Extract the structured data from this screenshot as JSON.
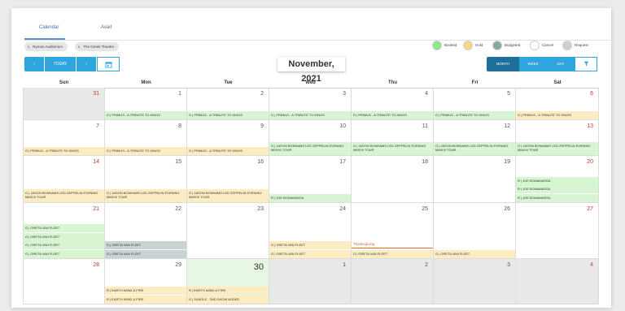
{
  "tabs": [
    {
      "label": "Calendar"
    },
    {
      "label": "Avail"
    }
  ],
  "filters": [
    {
      "label": "Ryman Auditorium",
      "remove": "x"
    },
    {
      "label": "The Greek Theatre",
      "remove": "x"
    }
  ],
  "legend": [
    {
      "label": "Booked",
      "color": "#90e88a"
    },
    {
      "label": "Hold",
      "color": "#f6d78a"
    },
    {
      "label": "Budgeted",
      "color": "#8aa7a5"
    },
    {
      "label": "Cancel",
      "color": "#ffffff"
    },
    {
      "label": "Request",
      "color": "#cfcfcf"
    }
  ],
  "nav": {
    "prev": "‹",
    "today": "TODAY",
    "next": "›",
    "calendar_icon": "calendar-icon"
  },
  "title": "November, 2021",
  "views": [
    {
      "label": "MONTH",
      "active": true
    },
    {
      "label": "WEEK",
      "active": false
    },
    {
      "label": "DAY",
      "active": false
    }
  ],
  "filter_icon": "filter-icon",
  "weekdays": [
    "Sun",
    "Mon",
    "Tue",
    "Wed",
    "Thu",
    "Fri",
    "Sat"
  ],
  "weeks": [
    {
      "days": [
        {
          "num": "31",
          "style": "gray",
          "red": true,
          "events": []
        },
        {
          "num": "1",
          "events": [
            {
              "text": "G | PRIMUS - A TRIBUTE TO KINGS",
              "type": "booked"
            }
          ]
        },
        {
          "num": "2",
          "events": [
            {
              "text": "G | PRIMUS - A TRIBUTE TO KINGS",
              "type": "booked"
            }
          ]
        },
        {
          "num": "3",
          "events": [
            {
              "text": "G | PRIMUS - A TRIBUTE TO KINGS",
              "type": "booked"
            }
          ]
        },
        {
          "num": "4",
          "events": [
            {
              "text": "G | PRIMUS - A TRIBUTE TO KINGS",
              "type": "booked"
            }
          ]
        },
        {
          "num": "5",
          "events": [
            {
              "text": "G | PRIMUS - A TRIBUTE TO KINGS",
              "type": "booked"
            }
          ]
        },
        {
          "num": "6",
          "red": true,
          "events": [
            {
              "text": "G | PRIMUS - A TRIBUTE TO KINGS",
              "type": "hold"
            }
          ]
        }
      ]
    },
    {
      "days": [
        {
          "num": "7",
          "red": true,
          "events": [
            {
              "text": "G | PRIMUS - A TRIBUTE TO KINGS",
              "type": "hold"
            }
          ]
        },
        {
          "num": "8",
          "events": [
            {
              "text": "G | PRIMUS - A TRIBUTE TO KINGS",
              "type": "hold"
            }
          ]
        },
        {
          "num": "9",
          "events": [
            {
              "text": "G | PRIMUS - A TRIBUTE TO KINGS",
              "type": "hold"
            }
          ]
        },
        {
          "num": "10",
          "events": [
            {
              "text": "G | JASON BONHAMS LED ZEPPELIN EVENING MMXXI TOUR",
              "type": "booked"
            }
          ]
        },
        {
          "num": "11",
          "events": [
            {
              "text": "G | JASON BONHAMS LED ZEPPELIN EVENING MMXXI TOUR",
              "type": "booked"
            }
          ]
        },
        {
          "num": "12",
          "events": [
            {
              "text": "G | JASON BONHAMS LED ZEPPELIN EVENING MMXXI TOUR",
              "type": "booked"
            }
          ]
        },
        {
          "num": "13",
          "red": true,
          "events": [
            {
              "text": "G | JASON BONHAMS LED ZEPPELIN EVENING MMXXI TOUR",
              "type": "booked"
            }
          ]
        }
      ]
    },
    {
      "days": [
        {
          "num": "14",
          "red": true,
          "events": [
            {
              "text": "G | JASON BONHAMS LED ZEPPELIN EVENING MMXXI TOUR",
              "type": "hold"
            }
          ]
        },
        {
          "num": "15",
          "events": [
            {
              "text": "G | JASON BONHAMS LED ZEPPELIN EVENING MMXXI TOUR",
              "type": "hold"
            }
          ]
        },
        {
          "num": "16",
          "events": [
            {
              "text": "G | JASON BONHAMS LED ZEPPELIN EVENING MMXXI TOUR",
              "type": "hold"
            }
          ]
        },
        {
          "num": "17",
          "events": [
            {
              "text": "R | JOE BONAMASSA",
              "type": "booked"
            }
          ]
        },
        {
          "num": "18",
          "events": []
        },
        {
          "num": "19",
          "events": []
        },
        {
          "num": "20",
          "red": true,
          "events": [
            {
              "text": "R | JOE BONAMASSA",
              "type": "booked"
            },
            {
              "text": "R | JOE BONAMASSA",
              "type": "booked"
            },
            {
              "text": "R | JOE BONAMASSA",
              "type": "booked"
            }
          ]
        }
      ]
    },
    {
      "days": [
        {
          "num": "21",
          "red": true,
          "events": [
            {
              "text": "G | GRETA VAN FLEET",
              "type": "booked"
            },
            {
              "text": "G | GRETA VAN FLEET",
              "type": "booked"
            },
            {
              "text": "G | GRETA VAN FLEET",
              "type": "booked"
            },
            {
              "text": "G | GRETA VAN FLEET",
              "type": "booked"
            }
          ]
        },
        {
          "num": "22",
          "events": [
            {
              "text": "G | GRETA VAN FLEET",
              "type": "budgeted"
            },
            {
              "text": "G | GRETA VAN FLEET",
              "type": "budgeted"
            }
          ]
        },
        {
          "num": "23",
          "events": []
        },
        {
          "num": "24",
          "events": [
            {
              "text": "G | GRETA VAN FLEET",
              "type": "hold"
            },
            {
              "text": "G | GRETA VAN FLEET",
              "type": "hold"
            }
          ]
        },
        {
          "num": "25",
          "holiday": "Thanksgiving",
          "events": [
            {
              "text": "G | GRETA VAN FLEET",
              "type": "hold"
            }
          ]
        },
        {
          "num": "26",
          "events": [
            {
              "text": "G | GRETA VAN FLEET",
              "type": "hold"
            }
          ]
        },
        {
          "num": "27",
          "red": true,
          "events": []
        }
      ]
    },
    {
      "days": [
        {
          "num": "28",
          "red": true,
          "events": []
        },
        {
          "num": "29",
          "events": [
            {
              "text": "R | EARTH WIND & FIRE",
              "type": "hold"
            },
            {
              "text": "R | EARTH WIND & FIRE",
              "type": "hold"
            }
          ]
        },
        {
          "num": "30",
          "style": "today",
          "big": true,
          "events": [
            {
              "text": "R | EARTH WIND & FIRE",
              "type": "hold"
            },
            {
              "text": "G | JUNGLE - 2ND SHOW ADDED",
              "type": "hold"
            }
          ]
        },
        {
          "num": "1",
          "style": "gray",
          "events": []
        },
        {
          "num": "2",
          "style": "gray",
          "events": []
        },
        {
          "num": "3",
          "style": "gray",
          "events": []
        },
        {
          "num": "4",
          "style": "gray",
          "red": true,
          "events": []
        }
      ]
    }
  ]
}
